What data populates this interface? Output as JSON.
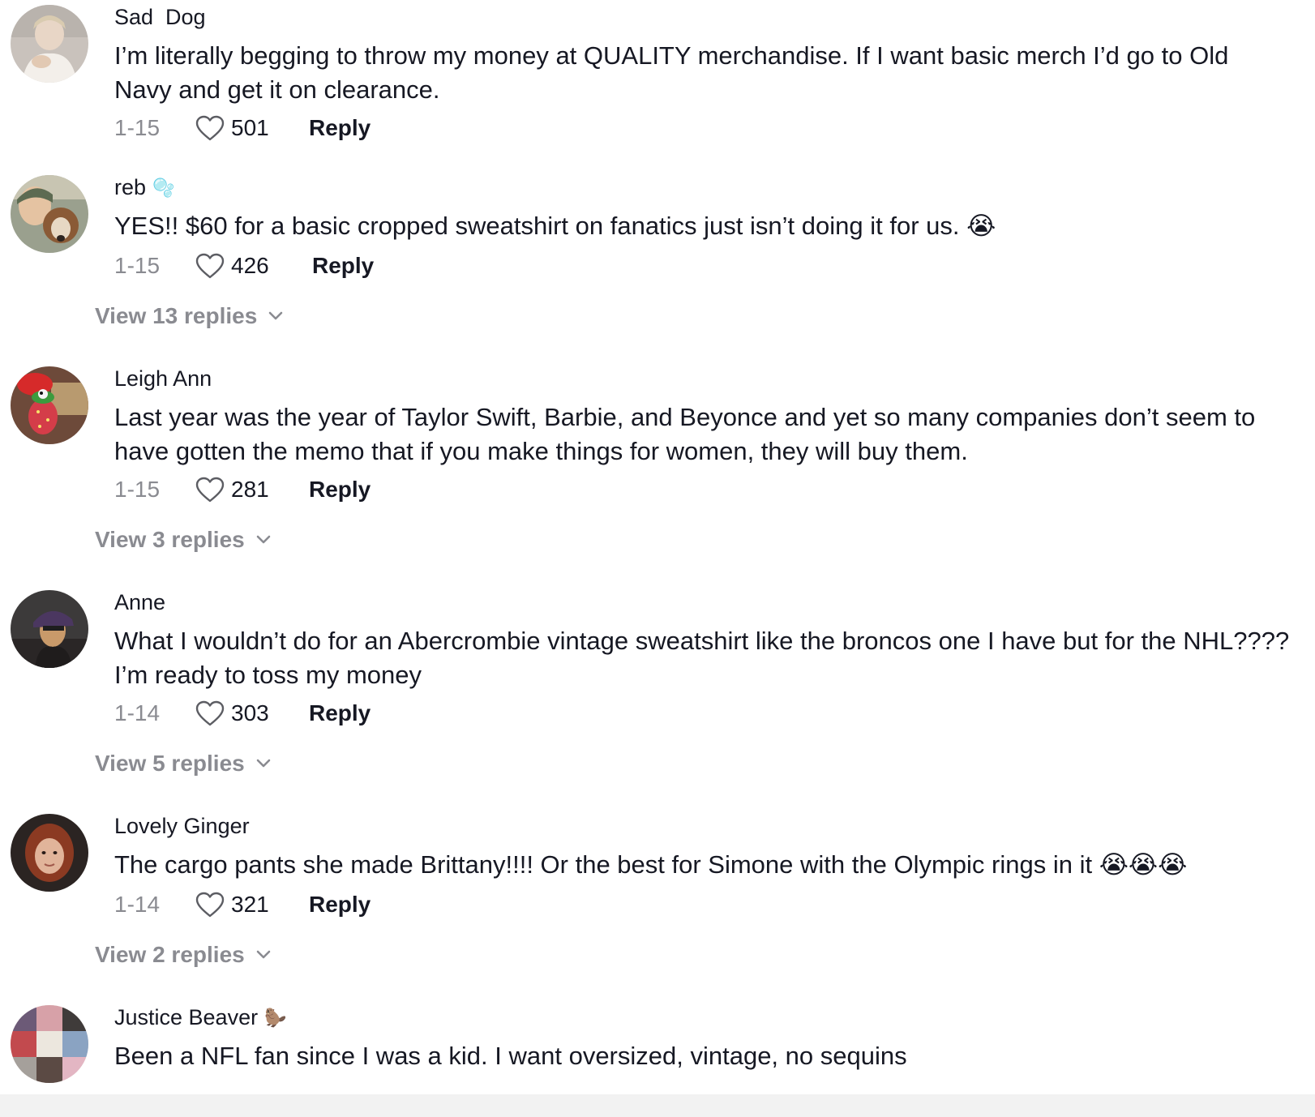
{
  "comments": [
    {
      "username": "Sad  Dog",
      "text": "I’m literally begging to throw my money at QUALITY merchandise. If I want basic merch I’d go to Old Navy and get it on clearance.",
      "date": "1-15",
      "likes": "501",
      "reply_label": "Reply",
      "avatar": "user-photo"
    },
    {
      "username": "reb",
      "badge": "🫧",
      "text": "YES!! $60 for a basic cropped sweatshirt on fanatics just isn’t doing it for us. 😭",
      "date": "1-15",
      "likes": "426",
      "reply_label": "Reply",
      "avatar": "user-photo-with-dog",
      "view_replies": "View 13 replies"
    },
    {
      "username": "Leigh Ann",
      "text": "Last year was the year of Taylor Swift, Barbie, and Beyonce and yet so many companies don’t seem to have gotten the memo that if you make things for women, they will buy them.",
      "date": "1-15",
      "likes": "281",
      "reply_label": "Reply",
      "avatar": "strawberry-figure",
      "view_replies": "View 3 replies"
    },
    {
      "username": "Anne",
      "text": "What I wouldn’t do for an Abercrombie vintage sweatshirt like the broncos one I have but for the NHL???? I’m ready to toss my money",
      "date": "1-14",
      "likes": "303",
      "reply_label": "Reply",
      "avatar": "user-photo-hat",
      "view_replies": "View 5 replies"
    },
    {
      "username": "Lovely Ginger",
      "text": "The cargo pants she made Brittany!!!! Or the best for Simone with the Olympic rings in it 😭😭😭",
      "date": "1-14",
      "likes": "321",
      "reply_label": "Reply",
      "avatar": "user-photo-redhead",
      "view_replies": "View 2 replies"
    },
    {
      "username": "Justice Beaver",
      "badge": "🦫",
      "text": "Been a NFL fan since I was a kid. I want oversized, vintage, no sequins",
      "avatar": "album-collage"
    }
  ],
  "colors": {
    "primary_text": "#161823",
    "secondary_text": "#8a8b91",
    "background": "#ffffff"
  },
  "icons": {
    "like": "heart-outline-icon",
    "expand": "chevron-down-icon"
  }
}
